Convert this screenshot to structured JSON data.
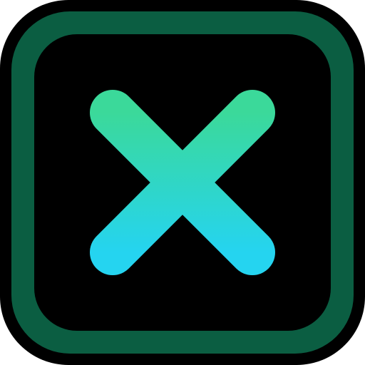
{
  "icon": {
    "name": "close-icon",
    "colors": {
      "outline": "#000000",
      "frame": "#0b5e42",
      "inner": "#000000",
      "cross_gradient_start": "#3bd99a",
      "cross_gradient_end": "#25d4f0"
    }
  }
}
